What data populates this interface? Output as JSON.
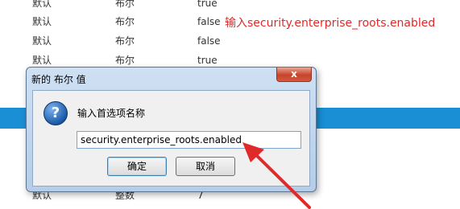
{
  "prefs": {
    "rows": [
      {
        "status": "默认",
        "type": "布尔",
        "value": "true"
      },
      {
        "status": "默认",
        "type": "布尔",
        "value": "false"
      },
      {
        "status": "默认",
        "type": "布尔",
        "value": "false"
      },
      {
        "status": "默认",
        "type": "布尔",
        "value": "true"
      },
      {
        "status": "默认",
        "type": "整数",
        "value": "7"
      }
    ]
  },
  "annotation": {
    "text": "输入security.enterprise_roots.enabled",
    "color": "#e02a2a"
  },
  "dialog": {
    "title": "新的 布尔 值",
    "close_label": "x",
    "prompt": "输入首选项名称",
    "input_value": "security.enterprise_roots.enabled",
    "ok_label": "确定",
    "cancel_label": "取消",
    "icon": "question-icon"
  },
  "colors": {
    "accent_band": "#1a8fd6",
    "annotation": "#e02a2a"
  }
}
